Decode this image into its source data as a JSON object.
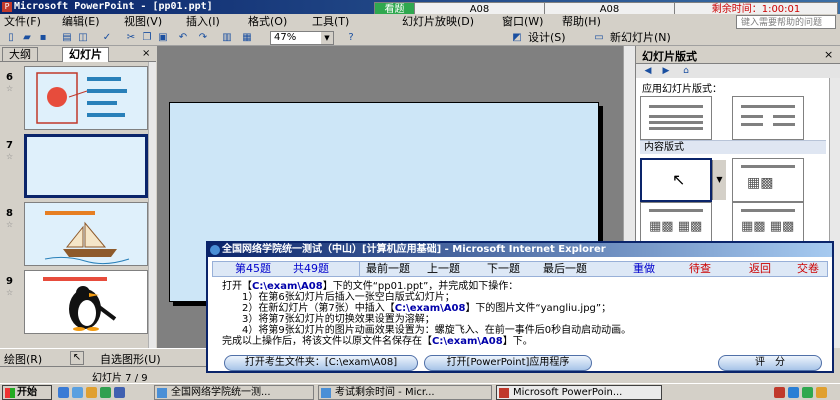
{
  "window": {
    "title": "Microsoft PowerPoint - [pp01.ppt]"
  },
  "exam_strip": {
    "label": "看题",
    "id1": "A08",
    "id2": "A08",
    "remaining": "剩余时间：1:00:01"
  },
  "menu": [
    "文件(F)",
    "编辑(E)",
    "视图(V)",
    "插入(I)",
    "格式(O)",
    "工具(T)",
    "幻灯片放映(D)",
    "窗口(W)",
    "帮助(H)"
  ],
  "help_box": {
    "placeholder": "键入需要帮助的问题"
  },
  "toolbar": {
    "zoom": "47%",
    "design_label": "设计(S)",
    "new_slide_label": "新幻灯片(N)"
  },
  "left_panel": {
    "tabs": [
      "大纲",
      "幻灯片"
    ],
    "close": "×",
    "thumbnails": [
      {
        "num": "6",
        "star": "☆"
      },
      {
        "num": "7",
        "star": "☆"
      },
      {
        "num": "8",
        "star": "☆"
      },
      {
        "num": "9",
        "star": "☆"
      }
    ]
  },
  "task_pane": {
    "title": "幻灯片版式",
    "close": "×",
    "apply_label": "应用幻灯片版式：",
    "content_section": "内容版式"
  },
  "dialog": {
    "title": "全国网络学院统一测试（中山）[计算机应用基础] - Microsoft Internet Explorer",
    "current": "第45题",
    "total": "共49题",
    "nav": [
      "最前一题",
      "上一题",
      "下一题",
      "最后一题"
    ],
    "actions": [
      "重做",
      "待查",
      "返回",
      "交卷"
    ],
    "task_lines": [
      {
        "pre": "打开【",
        "hl": "C:\\exam\\A08",
        "post": "】下的文件“pp01.ppt”，并完成如下操作："
      },
      {
        "pre": "1）在第6张幻灯片后插入一张空白版式幻灯片；",
        "hl": "",
        "post": ""
      },
      {
        "pre": "2）在新幻灯片（第7张）中插入【",
        "hl": "C:\\exam\\A08",
        "post": "】下的图片文件“yangliu.jpg”；"
      },
      {
        "pre": "3）将第7张幻灯片的切换效果设置为溶解；",
        "hl": "",
        "post": ""
      },
      {
        "pre": "4）将第9张幻灯片的图片动画效果设置为：螺旋飞入、在前一事件后0秒自动启动动画。",
        "hl": "",
        "post": ""
      },
      {
        "pre": "完成以上操作后，将该文件以原文件名保存在【",
        "hl": "C:\\exam\\A08",
        "post": "】下。"
      }
    ],
    "btn_open_folder": "打开考生文件夹：[C:\\exam\\A08]",
    "btn_open_app": "打开[PowerPoint]应用程序",
    "btn_score": "评　分"
  },
  "draw_bar": {
    "draw": "绘图(R)",
    "autoshape": "自选图形(U)"
  },
  "status_bar": {
    "slide": "幻灯片 7 / 9"
  },
  "taskbar": {
    "start": "开始",
    "tasks": [
      "全国网络学院统一测...",
      "考试剩余时间 - Micr...",
      "Microsoft PowerPoin..."
    ]
  }
}
